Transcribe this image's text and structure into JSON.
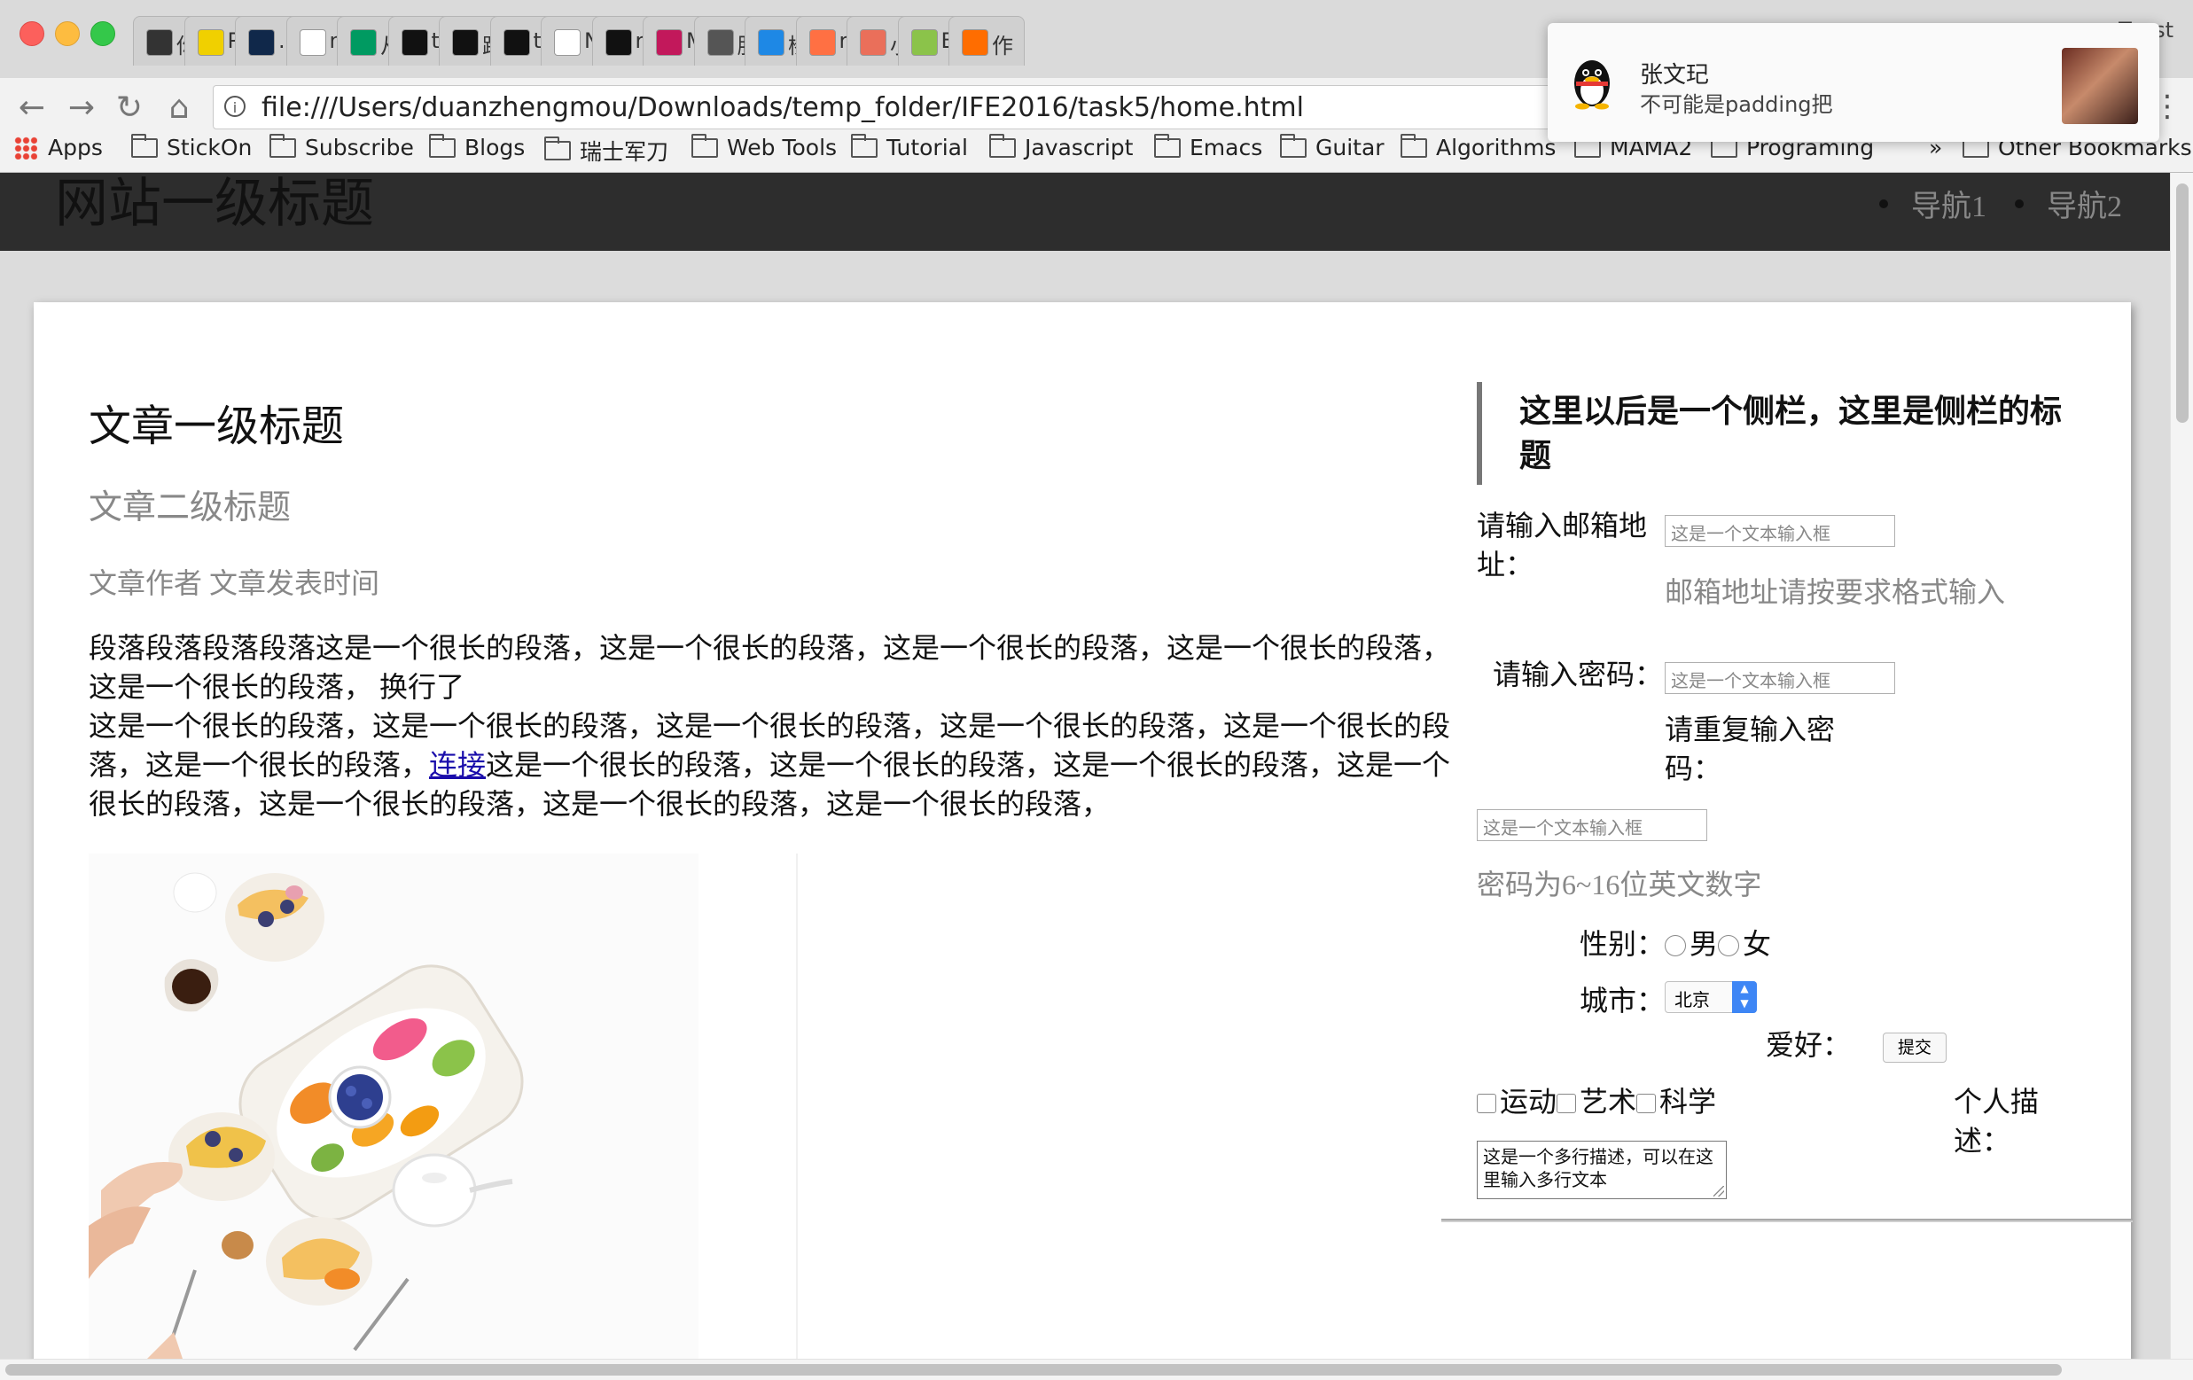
{
  "browser": {
    "tabs": [
      {
        "icon": "dark-square-icon",
        "label": "你",
        "color": "#333333"
      },
      {
        "icon": "es-icon",
        "label": "Pi",
        "color": "#f0d000"
      },
      {
        "icon": "swirl-icon",
        "label": ".p",
        "color": "#10284a"
      },
      {
        "icon": "calligraphy-icon",
        "label": "no",
        "color": "#ffffff"
      },
      {
        "icon": "sf-icon",
        "label": "从",
        "color": "#009a61"
      },
      {
        "icon": "film-icon",
        "label": "tc",
        "color": "#111111"
      },
      {
        "icon": "film-icon",
        "label": "跗",
        "color": "#111111"
      },
      {
        "icon": "film-icon",
        "label": "tc",
        "color": "#111111"
      },
      {
        "icon": "page-icon",
        "label": "N",
        "color": "#ffffff"
      },
      {
        "icon": "github-icon",
        "label": "re",
        "color": "#111111"
      },
      {
        "icon": "m-icon",
        "label": "M",
        "color": "#c2185b"
      },
      {
        "icon": "book-icon",
        "label": "肝",
        "color": "#555555"
      },
      {
        "icon": "blue-icon",
        "label": "榛",
        "color": "#1e88e5"
      },
      {
        "icon": "orange-circle-icon",
        "label": "re",
        "color": "#ff7043"
      },
      {
        "icon": "jian-icon",
        "label": "小",
        "color": "#ea6f5a"
      },
      {
        "icon": "leaf-icon",
        "label": "B",
        "color": "#8bc34a"
      },
      {
        "icon": "m-orange-icon",
        "label": "作",
        "color": "#ff6d00"
      }
    ],
    "toast_label": "Toast",
    "url": "file:///Users/duanzhengmou/Downloads/temp_folder/IFE2016/task5/home.html",
    "bookmarks": [
      "Apps",
      "StickOn",
      "Subscribe",
      "Blogs",
      "瑞士军刀",
      "Web Tools",
      "Tutorial",
      "Javascript",
      "Emacs",
      "Guitar",
      "Algorithms",
      "MAMA2",
      "Programing",
      "»",
      "Other Bookmarks"
    ]
  },
  "notification": {
    "app_icon": "qq-penguin-icon",
    "sender": "张文玘",
    "message": "不可能是padding把"
  },
  "site": {
    "title": "网站一级标题",
    "nav": [
      "导航1",
      "导航2"
    ]
  },
  "article": {
    "h1": "文章一级标题",
    "h2": "文章二级标题",
    "meta": "文章作者 文章发表时间",
    "para1": "段落段落段落段落这是一个很长的段落，这是一个很长的段落，这是一个很长的段落，这是一个很长的段落，这是一个很长的段落， 换行了",
    "para2_before": "这是一个很长的段落，这是一个很长的段落，这是一个很长的段落，这是一个很长的段落，这是一个很长的段落，这是一个很长的段落，",
    "link": "连接",
    "para2_after": "这是一个很长的段落，这是一个很长的段落，这是一个很长的段落，这是一个很长的段落，这是一个很长的段落，这是一个很长的段落，这是一个很长的段落，"
  },
  "sidebar": {
    "title": "这里以后是一个侧栏，这里是侧栏的标题",
    "email_label": "请输入邮箱地址：",
    "email_placeholder": "这是一个文本输入框",
    "email_hint": "邮箱地址请按要求格式输入",
    "password_label": "请输入密码：",
    "password_placeholder": "这是一个文本输入框",
    "repeat_label": "请重复输入密码：",
    "repeat_placeholder": "这是一个文本输入框",
    "password_hint": "密码为6~16位英文数字",
    "gender_label": "性别：",
    "gender_options": [
      "男",
      "女"
    ],
    "city_label": "城市：",
    "city_value": "北京",
    "hobby_label": "爱好：",
    "submit_label": "提交",
    "hobbies": [
      "运动",
      "艺术",
      "科学"
    ],
    "desc_label": "个人描述：",
    "desc_value": "这是一个多行描述，可以在这里输入多行文本"
  }
}
